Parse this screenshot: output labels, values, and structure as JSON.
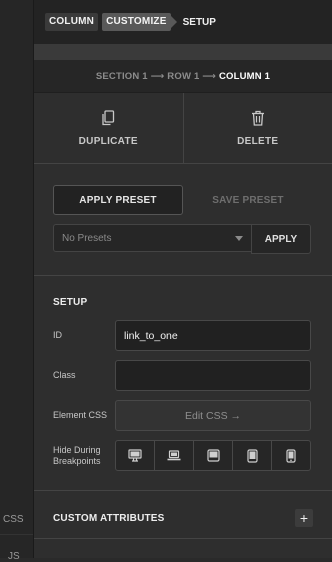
{
  "sidebar": {
    "css_label": "CSS",
    "js_label": "JS"
  },
  "breadcrumb": {
    "column": "COLUMN",
    "customize": "CUSTOMIZE",
    "setup": "SETUP"
  },
  "path": {
    "section": "SECTION 1",
    "arrow": "⟶",
    "row": "ROW 1",
    "column": "COLUMN 1"
  },
  "actions": {
    "duplicate": "DUPLICATE",
    "delete": "DELETE"
  },
  "presets": {
    "apply_preset": "APPLY PRESET",
    "save_preset": "SAVE PRESET",
    "select_value": "No Presets",
    "apply": "APPLY"
  },
  "setup": {
    "title": "SETUP",
    "id_label": "ID",
    "id_value": "link_to_one",
    "class_label": "Class",
    "class_value": "",
    "element_css_label": "Element CSS",
    "edit_css": "Edit CSS →",
    "hide_label": "Hide During Breakpoints",
    "breakpoints": [
      "desktop-icon",
      "laptop-icon",
      "tablet-landscape-icon",
      "tablet-portrait-icon",
      "mobile-icon"
    ]
  },
  "custom_attributes": {
    "title": "CUSTOM ATTRIBUTES",
    "add": "+"
  }
}
